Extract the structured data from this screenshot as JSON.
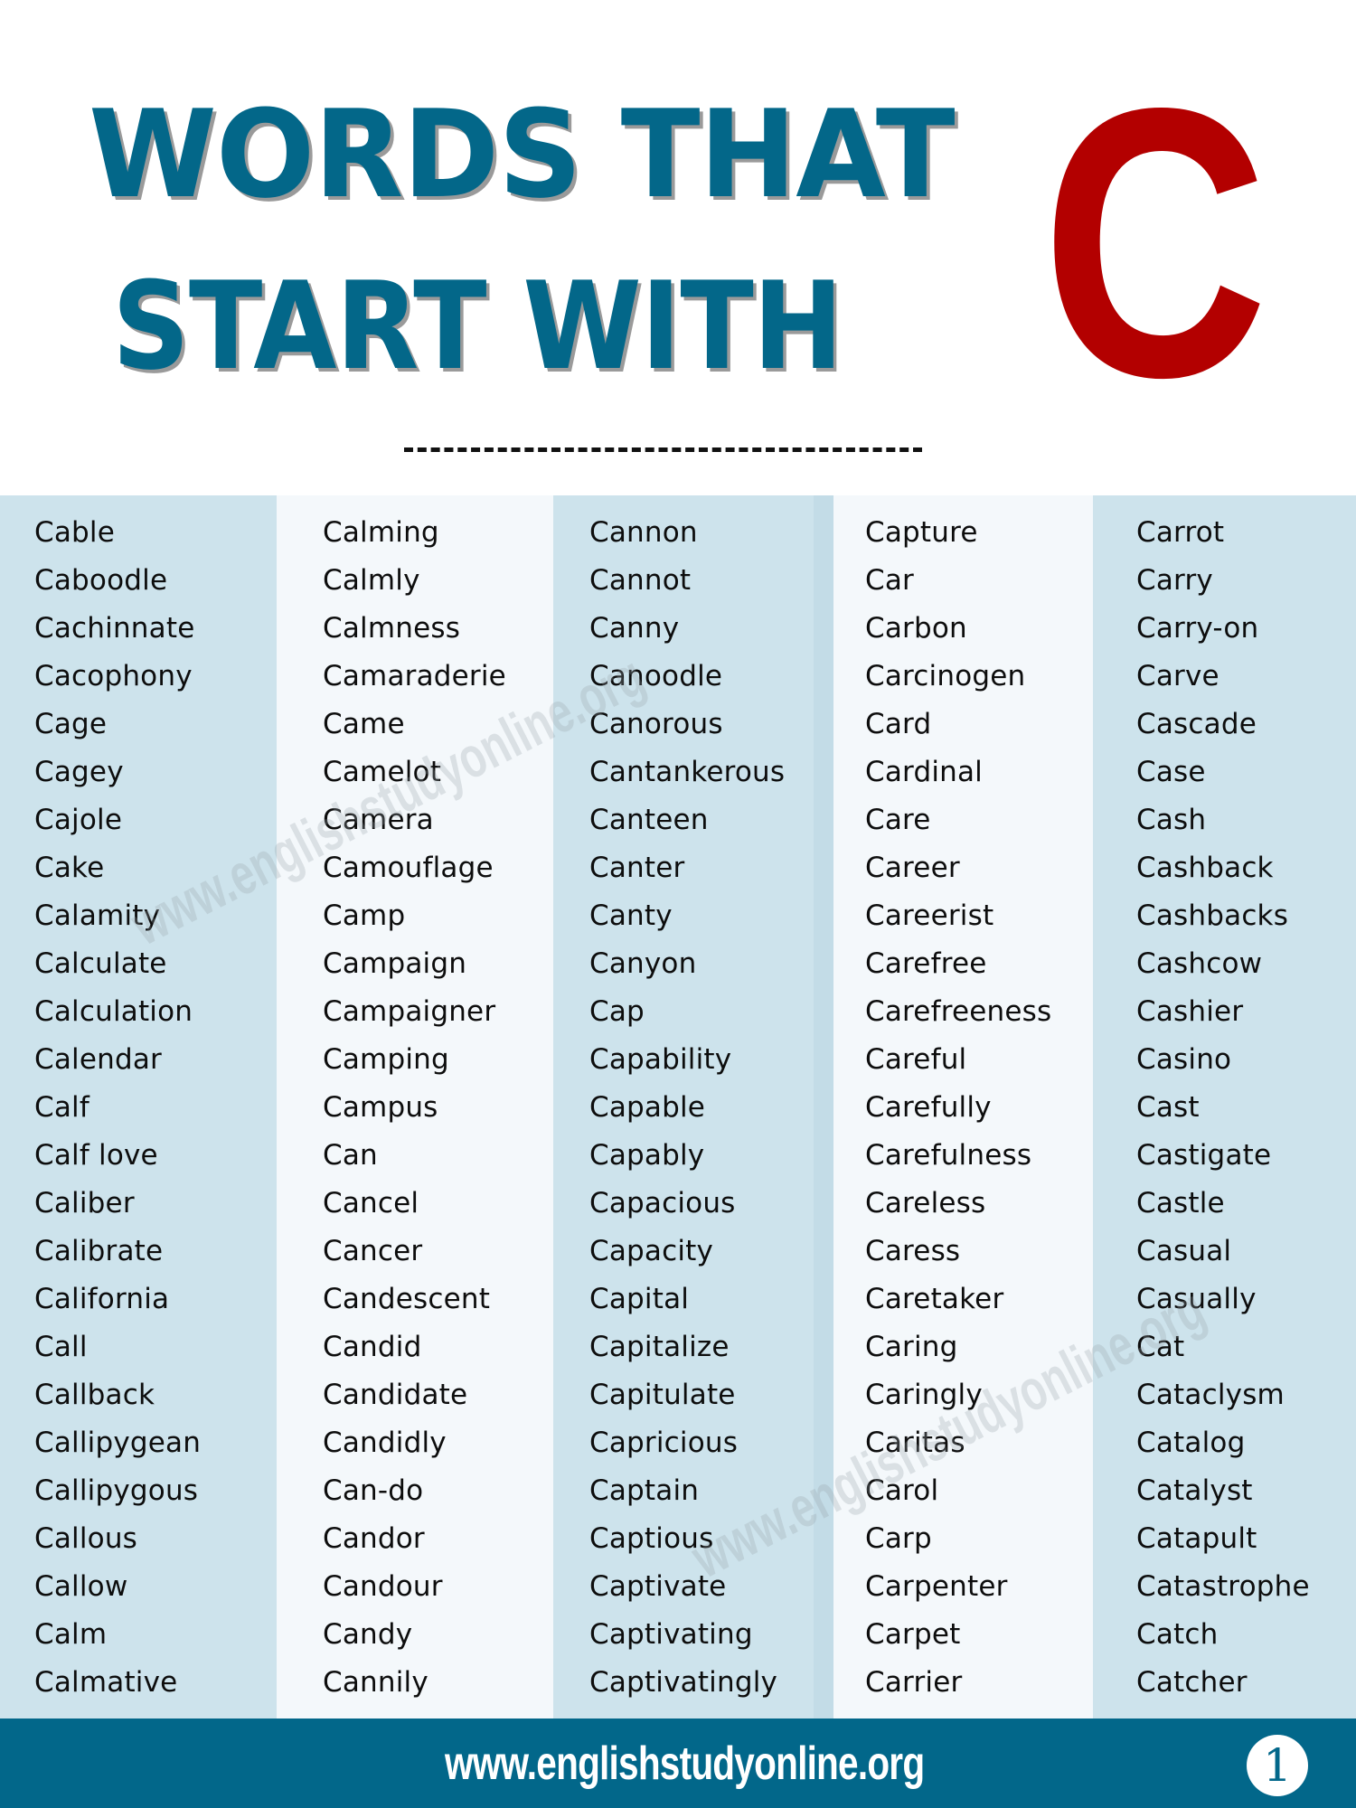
{
  "header": {
    "title_line_1": "WORDS THAT",
    "title_line_2": "START WITH",
    "letter": "C",
    "divider_icon": "dashed-line"
  },
  "colors": {
    "title": "#036789",
    "letter": "#b30000",
    "column_dark": "#cde3ec",
    "column_light": "#f4f8fb",
    "footer": "#02678a"
  },
  "columns": [
    {
      "words": [
        "Cable",
        "Caboodle",
        "Cachinnate",
        "Cacophony",
        "Cage",
        "Cagey",
        "Cajole",
        "Cake",
        "Calamity",
        "Calculate",
        "Calculation",
        "Calendar",
        "Calf",
        "Calf love",
        "Caliber",
        "Calibrate",
        "California",
        "Call",
        "Callback",
        "Callipygean",
        "Callipygous",
        "Callous",
        "Callow",
        "Calm",
        "Calmative"
      ]
    },
    {
      "words": [
        "Calming",
        "Calmly",
        "Calmness",
        "Camaraderie",
        "Came",
        "Camelot",
        "Camera",
        "Camouflage",
        "Camp",
        "Campaign",
        "Campaigner",
        "Camping",
        "Campus",
        "Can",
        "Cancel",
        "Cancer",
        "Candescent",
        "Candid",
        "Candidate",
        "Candidly",
        "Can-do",
        "Candor",
        "Candour",
        "Candy",
        "Cannily"
      ]
    },
    {
      "words": [
        "Cannon",
        "Cannot",
        "Canny",
        "Canoodle",
        "Canorous",
        "Cantankerous",
        "Canteen",
        "Canter",
        "Canty",
        "Canyon",
        "Cap",
        "Capability",
        "Capable",
        "Capably",
        "Capacious",
        "Capacity",
        "Capital",
        "Capitalize",
        "Capitulate",
        "Capricious",
        "Captain",
        "Captious",
        "Captivate",
        "Captivating",
        "Captivatingly"
      ]
    },
    {
      "words": [
        "Capture",
        "Car",
        "Carbon",
        "Carcinogen",
        "Card",
        "Cardinal",
        "Care",
        "Career",
        "Careerist",
        "Carefree",
        "Carefreeness",
        "Careful",
        "Carefully",
        "Carefulness",
        "Careless",
        "Caress",
        "Caretaker",
        "Caring",
        "Caringly",
        "Caritas",
        "Carol",
        "Carp",
        "Carpenter",
        "Carpet",
        "Carrier"
      ]
    },
    {
      "words": [
        "Carrot",
        "Carry",
        "Carry-on",
        "Carve",
        "Cascade",
        "Case",
        "Cash",
        "Cashback",
        "Cashbacks",
        "Cashcow",
        "Cashier",
        "Casino",
        "Cast",
        "Castigate",
        "Castle",
        "Casual",
        "Casually",
        "Cat",
        "Cataclysm",
        "Catalog",
        "Catalyst",
        "Catapult",
        "Catastrophe",
        "Catch",
        "Catcher"
      ]
    }
  ],
  "watermark": "www.englishstudyonline.org",
  "footer": {
    "url": "www.englishstudyonline.org",
    "page_number": "1"
  }
}
